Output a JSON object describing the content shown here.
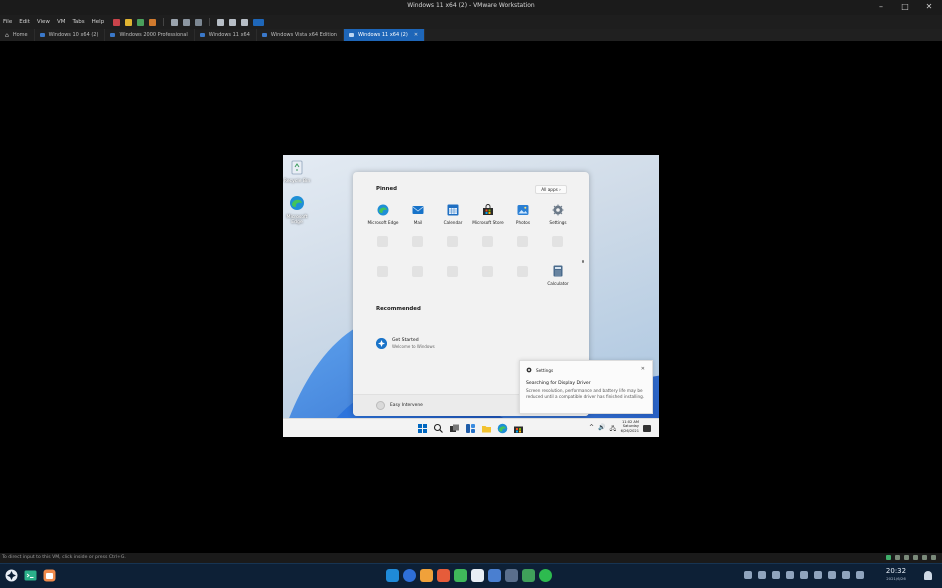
{
  "window": {
    "title": "Windows 11 x64 (2) - VMware Workstation",
    "controls": [
      "–",
      "□",
      "✕"
    ]
  },
  "menubar": {
    "items": [
      "File",
      "Edit",
      "View",
      "VM",
      "Tabs",
      "Help"
    ]
  },
  "tabs": [
    {
      "label": "Home",
      "active": false
    },
    {
      "label": "Windows 10 x64 (2)",
      "active": false
    },
    {
      "label": "Windows 2000 Professional",
      "active": false
    },
    {
      "label": "Windows 11 x64",
      "active": false
    },
    {
      "label": "Windows Vista x64 Edition",
      "active": false
    },
    {
      "label": "Windows 11 x64 (2)",
      "active": true
    }
  ],
  "desktop": {
    "icons": [
      {
        "label": "Recycle Bin",
        "icon": "recycle-bin-icon"
      },
      {
        "label": "Microsoft Edge",
        "icon": "edge-icon"
      }
    ]
  },
  "start_menu": {
    "pinned_title": "Pinned",
    "all_apps_label": "All apps  ›",
    "pinned": [
      {
        "label": "Microsoft Edge",
        "icon": "edge-icon",
        "color": "#1f8fd6"
      },
      {
        "label": "Mail",
        "icon": "mail-icon",
        "color": "#1773c9"
      },
      {
        "label": "Calendar",
        "icon": "calendar-icon",
        "color": "#1f6fc2"
      },
      {
        "label": "Microsoft Store",
        "icon": "store-icon",
        "color": "#2b2b2b"
      },
      {
        "label": "Photos",
        "icon": "photos-icon",
        "color": "#2a7fd4"
      },
      {
        "label": "Settings",
        "icon": "settings-icon",
        "color": "#6c7a89"
      },
      {
        "label": "Calculator",
        "icon": "calculator-icon",
        "color": "#4a6b8c"
      }
    ],
    "recommended_title": "Recommended",
    "recommended": [
      {
        "title": "Get Started",
        "subtitle": "Welcome to Windows"
      }
    ],
    "user_name": "Easy Intervene"
  },
  "toast": {
    "app": "Settings",
    "title": "Searching for Display Driver",
    "body": "Screen resolution, performance and battery life may be reduced until a compatible driver has finished installing.",
    "close": "✕"
  },
  "win_taskbar": {
    "clock": {
      "time": "11:02 AM",
      "day": "Saturday",
      "date": "6/26/2021"
    },
    "tray": [
      "^",
      "🔊",
      "🖧"
    ]
  },
  "statusbar": {
    "text": "To direct input to this VM, click inside or press Ctrl+G."
  },
  "host_taskbar": {
    "clock": {
      "time": "20:32",
      "date": "2021/6/26"
    }
  },
  "colors": {
    "accent": "#1e66b8",
    "host_taskbar": "#0d2036",
    "win_accent": "#0067c0"
  }
}
